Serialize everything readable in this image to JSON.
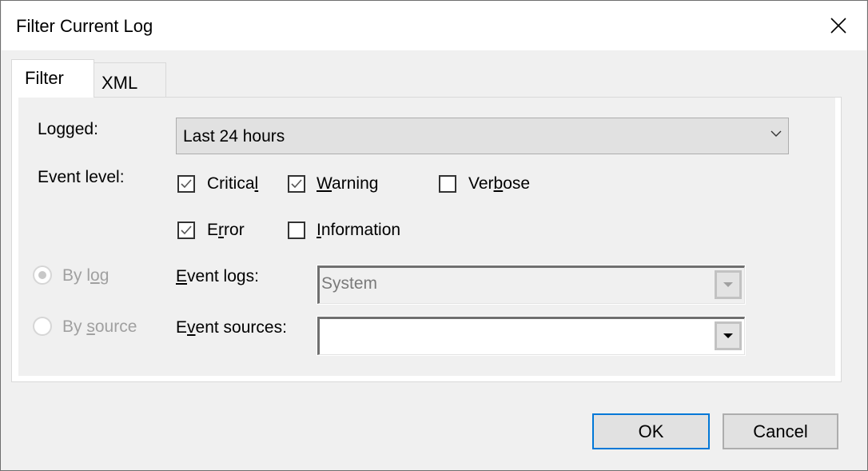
{
  "window": {
    "title": "Filter Current Log",
    "close_icon": "close-icon"
  },
  "tabs": [
    {
      "label": "Filter",
      "active": true
    },
    {
      "label": "XML",
      "active": false
    }
  ],
  "filter": {
    "logged": {
      "label_pre": "Lo",
      "label_u": "g",
      "label_post": "ged:",
      "value": "Last 24 hours"
    },
    "event_level": {
      "label": "Event level:",
      "options": {
        "critical": {
          "pre": "Critica",
          "u": "l",
          "post": "",
          "checked": true
        },
        "warning": {
          "pre": "",
          "u": "W",
          "post": "arning",
          "checked": true
        },
        "verbose": {
          "pre": "Ver",
          "u": "b",
          "post": "ose",
          "checked": false
        },
        "error": {
          "pre": "E",
          "u": "r",
          "post": "ror",
          "checked": true
        },
        "information": {
          "pre": "",
          "u": "I",
          "post": "nformation",
          "checked": false
        }
      }
    },
    "by_log": {
      "pre": "By l",
      "u": "o",
      "post": "g",
      "selected": true,
      "enabled": false
    },
    "by_source": {
      "pre": "By ",
      "u": "s",
      "post": "ource",
      "selected": false,
      "enabled": false
    },
    "event_logs": {
      "pre": "",
      "u": "E",
      "post": "vent logs:",
      "value": "System",
      "enabled": false
    },
    "event_sources": {
      "pre": "E",
      "u": "v",
      "post": "ent sources:",
      "value": ""
    }
  },
  "buttons": {
    "ok": "OK",
    "cancel": "Cancel"
  },
  "colors": {
    "accent": "#0078d7",
    "dialog_bg": "#f0f0f0",
    "disabled_text": "#a0a0a0"
  }
}
